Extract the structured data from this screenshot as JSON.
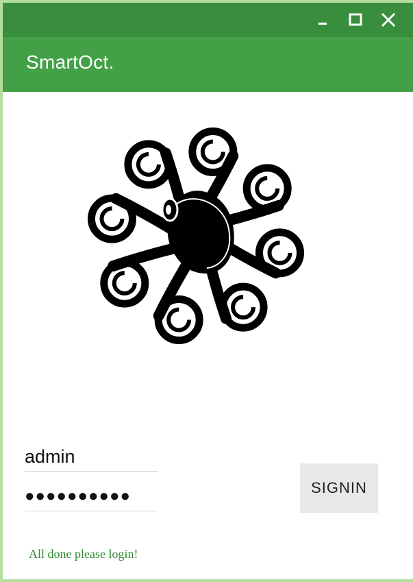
{
  "window": {
    "controls": {
      "minimize": "minimize-icon",
      "maximize": "maximize-icon",
      "close": "close-icon"
    }
  },
  "appbar": {
    "title": "SmartOct."
  },
  "logo": {
    "icon": "octopus-logo"
  },
  "login": {
    "username": "admin",
    "password": "●●●●●●●●●●",
    "signin_label": "SIGNIN"
  },
  "status": {
    "message": "All done please login!"
  },
  "colors": {
    "titlebar": "#388e3c",
    "appbar": "#43a047",
    "window_border": "#b5dd9e",
    "status_text": "#2e8b2e",
    "signin_bg": "#e8e8e8"
  }
}
